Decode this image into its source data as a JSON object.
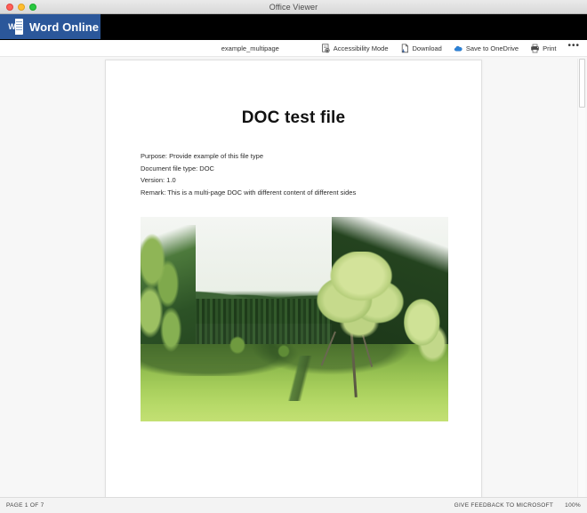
{
  "window": {
    "title": "Office Viewer",
    "traffic_lights": [
      "close",
      "minimize",
      "zoom"
    ]
  },
  "brand": {
    "label": "Word Online",
    "icon": "word-document-icon",
    "icon_letter": "W",
    "background_color": "#2b579a"
  },
  "toolbar": {
    "filename": "example_multipage",
    "items": [
      {
        "label": "Accessibility Mode",
        "icon": "accessibility-mode-icon"
      },
      {
        "label": "Download",
        "icon": "download-icon"
      },
      {
        "label": "Save to OneDrive",
        "icon": "onedrive-cloud-icon"
      },
      {
        "label": "Print",
        "icon": "printer-icon"
      }
    ],
    "overflow_label": "•••"
  },
  "document": {
    "title": "DOC test file",
    "lines": [
      "Purpose: Provide example of this file type",
      "Document file type: DOC",
      "Version: 1.0",
      "Remark: This is a multi-page DOC with different content of different sides"
    ],
    "image_alt": "Green meadow valley with large leafy tree and coniferous forest hillside"
  },
  "statusbar": {
    "page_indicator": "PAGE 1 OF 7",
    "feedback_label": "GIVE FEEDBACK TO MICROSOFT",
    "zoom_level": "100%"
  }
}
